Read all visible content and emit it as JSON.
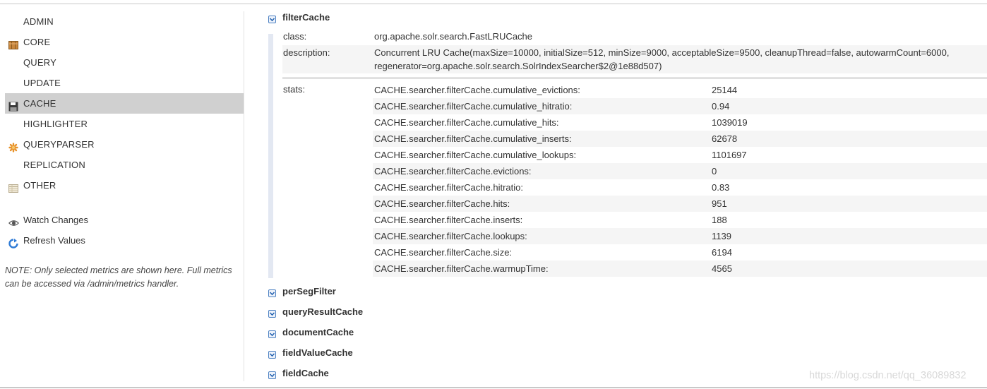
{
  "sidebar": {
    "categories": [
      {
        "label": "ADMIN",
        "icon": "none"
      },
      {
        "label": "CORE",
        "icon": "core-icon"
      },
      {
        "label": "QUERY",
        "icon": "none"
      },
      {
        "label": "UPDATE",
        "icon": "none"
      },
      {
        "label": "CACHE",
        "icon": "floppy-disk-icon",
        "active": true
      },
      {
        "label": "HIGHLIGHTER",
        "icon": "none"
      },
      {
        "label": "QUERYPARSER",
        "icon": "star-icon"
      },
      {
        "label": "REPLICATION",
        "icon": "none"
      },
      {
        "label": "OTHER",
        "icon": "table-icon"
      }
    ],
    "watch_changes": "Watch Changes",
    "refresh_values": "Refresh Values",
    "note": "NOTE: Only selected metrics are shown here. Full metrics can be accessed via /admin/metrics handler."
  },
  "main": {
    "expanded": {
      "name": "filterCache",
      "class_label": "class:",
      "class_value": "org.apache.solr.search.FastLRUCache",
      "description_label": "description:",
      "description_line1": "Concurrent LRU Cache(maxSize=10000, initialSize=512, minSize=9000, acceptableSize=9500, cleanupThread=false, autowarmCount=6000,",
      "description_line2": "regenerator=org.apache.solr.search.SolrIndexSearcher$2@1e88d507)",
      "stats_label": "stats:",
      "stats": [
        {
          "name": "CACHE.searcher.filterCache.cumulative_evictions:",
          "value": "25144"
        },
        {
          "name": "CACHE.searcher.filterCache.cumulative_hitratio:",
          "value": "0.94"
        },
        {
          "name": "CACHE.searcher.filterCache.cumulative_hits:",
          "value": "1039019"
        },
        {
          "name": "CACHE.searcher.filterCache.cumulative_inserts:",
          "value": "62678"
        },
        {
          "name": "CACHE.searcher.filterCache.cumulative_lookups:",
          "value": "1101697"
        },
        {
          "name": "CACHE.searcher.filterCache.evictions:",
          "value": "0"
        },
        {
          "name": "CACHE.searcher.filterCache.hitratio:",
          "value": "0.83"
        },
        {
          "name": "CACHE.searcher.filterCache.hits:",
          "value": "951"
        },
        {
          "name": "CACHE.searcher.filterCache.inserts:",
          "value": "188"
        },
        {
          "name": "CACHE.searcher.filterCache.lookups:",
          "value": "1139"
        },
        {
          "name": "CACHE.searcher.filterCache.size:",
          "value": "6194"
        },
        {
          "name": "CACHE.searcher.filterCache.warmupTime:",
          "value": "4565"
        }
      ]
    },
    "collapsed": [
      "perSegFilter",
      "queryResultCache",
      "documentCache",
      "fieldValueCache",
      "fieldCache"
    ]
  },
  "watermark": "https://blog.csdn.net/qq_36089832",
  "colors": {
    "accent_blue": "#4a7fc1",
    "active_bg": "#d0d0d0",
    "row_alt_bg": "#f5f5f5"
  }
}
